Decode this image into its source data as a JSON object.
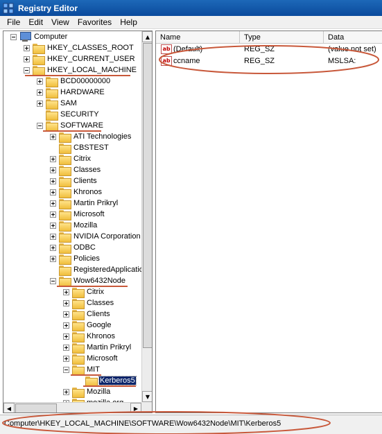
{
  "window": {
    "title": "Registry Editor"
  },
  "menu": [
    "File",
    "Edit",
    "View",
    "Favorites",
    "Help"
  ],
  "tree": [
    {
      "label": "Computer",
      "indent": 0,
      "toggle": "minus",
      "icon": "computer"
    },
    {
      "label": "HKEY_CLASSES_ROOT",
      "indent": 1,
      "toggle": "plus",
      "icon": "folder"
    },
    {
      "label": "HKEY_CURRENT_USER",
      "indent": 1,
      "toggle": "plus",
      "icon": "folder"
    },
    {
      "label": "HKEY_LOCAL_MACHINE",
      "indent": 1,
      "toggle": "minus",
      "icon": "folder"
    },
    {
      "label": "BCD00000000",
      "indent": 2,
      "toggle": "plus",
      "icon": "folder"
    },
    {
      "label": "HARDWARE",
      "indent": 2,
      "toggle": "plus",
      "icon": "folder"
    },
    {
      "label": "SAM",
      "indent": 2,
      "toggle": "plus",
      "icon": "folder"
    },
    {
      "label": "SECURITY",
      "indent": 2,
      "toggle": "none",
      "icon": "folder"
    },
    {
      "label": "SOFTWARE",
      "indent": 2,
      "toggle": "minus",
      "icon": "folder"
    },
    {
      "label": "ATI Technologies",
      "indent": 3,
      "toggle": "plus",
      "icon": "folder"
    },
    {
      "label": "CBSTEST",
      "indent": 3,
      "toggle": "none",
      "icon": "folder"
    },
    {
      "label": "Citrix",
      "indent": 3,
      "toggle": "plus",
      "icon": "folder"
    },
    {
      "label": "Classes",
      "indent": 3,
      "toggle": "plus",
      "icon": "folder"
    },
    {
      "label": "Clients",
      "indent": 3,
      "toggle": "plus",
      "icon": "folder"
    },
    {
      "label": "Khronos",
      "indent": 3,
      "toggle": "plus",
      "icon": "folder"
    },
    {
      "label": "Martin Prikryl",
      "indent": 3,
      "toggle": "plus",
      "icon": "folder"
    },
    {
      "label": "Microsoft",
      "indent": 3,
      "toggle": "plus",
      "icon": "folder"
    },
    {
      "label": "Mozilla",
      "indent": 3,
      "toggle": "plus",
      "icon": "folder"
    },
    {
      "label": "NVIDIA Corporation",
      "indent": 3,
      "toggle": "plus",
      "icon": "folder"
    },
    {
      "label": "ODBC",
      "indent": 3,
      "toggle": "plus",
      "icon": "folder"
    },
    {
      "label": "Policies",
      "indent": 3,
      "toggle": "plus",
      "icon": "folder"
    },
    {
      "label": "RegisteredApplicatio",
      "indent": 3,
      "toggle": "none",
      "icon": "folder"
    },
    {
      "label": "Wow6432Node",
      "indent": 3,
      "toggle": "minus",
      "icon": "folder"
    },
    {
      "label": "Citrix",
      "indent": 4,
      "toggle": "plus",
      "icon": "folder"
    },
    {
      "label": "Classes",
      "indent": 4,
      "toggle": "plus",
      "icon": "folder"
    },
    {
      "label": "Clients",
      "indent": 4,
      "toggle": "plus",
      "icon": "folder"
    },
    {
      "label": "Google",
      "indent": 4,
      "toggle": "plus",
      "icon": "folder"
    },
    {
      "label": "Khronos",
      "indent": 4,
      "toggle": "plus",
      "icon": "folder"
    },
    {
      "label": "Martin Prikryl",
      "indent": 4,
      "toggle": "plus",
      "icon": "folder"
    },
    {
      "label": "Microsoft",
      "indent": 4,
      "toggle": "plus",
      "icon": "folder"
    },
    {
      "label": "MIT",
      "indent": 4,
      "toggle": "minus",
      "icon": "folder"
    },
    {
      "label": "Kerberos5",
      "indent": 5,
      "toggle": "none",
      "icon": "folder",
      "selected": true
    },
    {
      "label": "Mozilla",
      "indent": 4,
      "toggle": "plus",
      "icon": "folder"
    },
    {
      "label": "mozilla.org",
      "indent": 4,
      "toggle": "plus",
      "icon": "folder"
    }
  ],
  "columns": {
    "name": "Name",
    "type": "Type",
    "data": "Data"
  },
  "values": [
    {
      "name": "(Default)",
      "type": "REG_SZ",
      "data": "(value not set)"
    },
    {
      "name": "ccname",
      "type": "REG_SZ",
      "data": "MSLSA:"
    }
  ],
  "status": {
    "path": "Computer\\HKEY_LOCAL_MACHINE\\SOFTWARE\\Wow6432Node\\MIT\\Kerberos5"
  },
  "colors": {
    "annotation": "#c8583a",
    "selection": "#0a246a",
    "titlebar": "#0a4a9c"
  }
}
